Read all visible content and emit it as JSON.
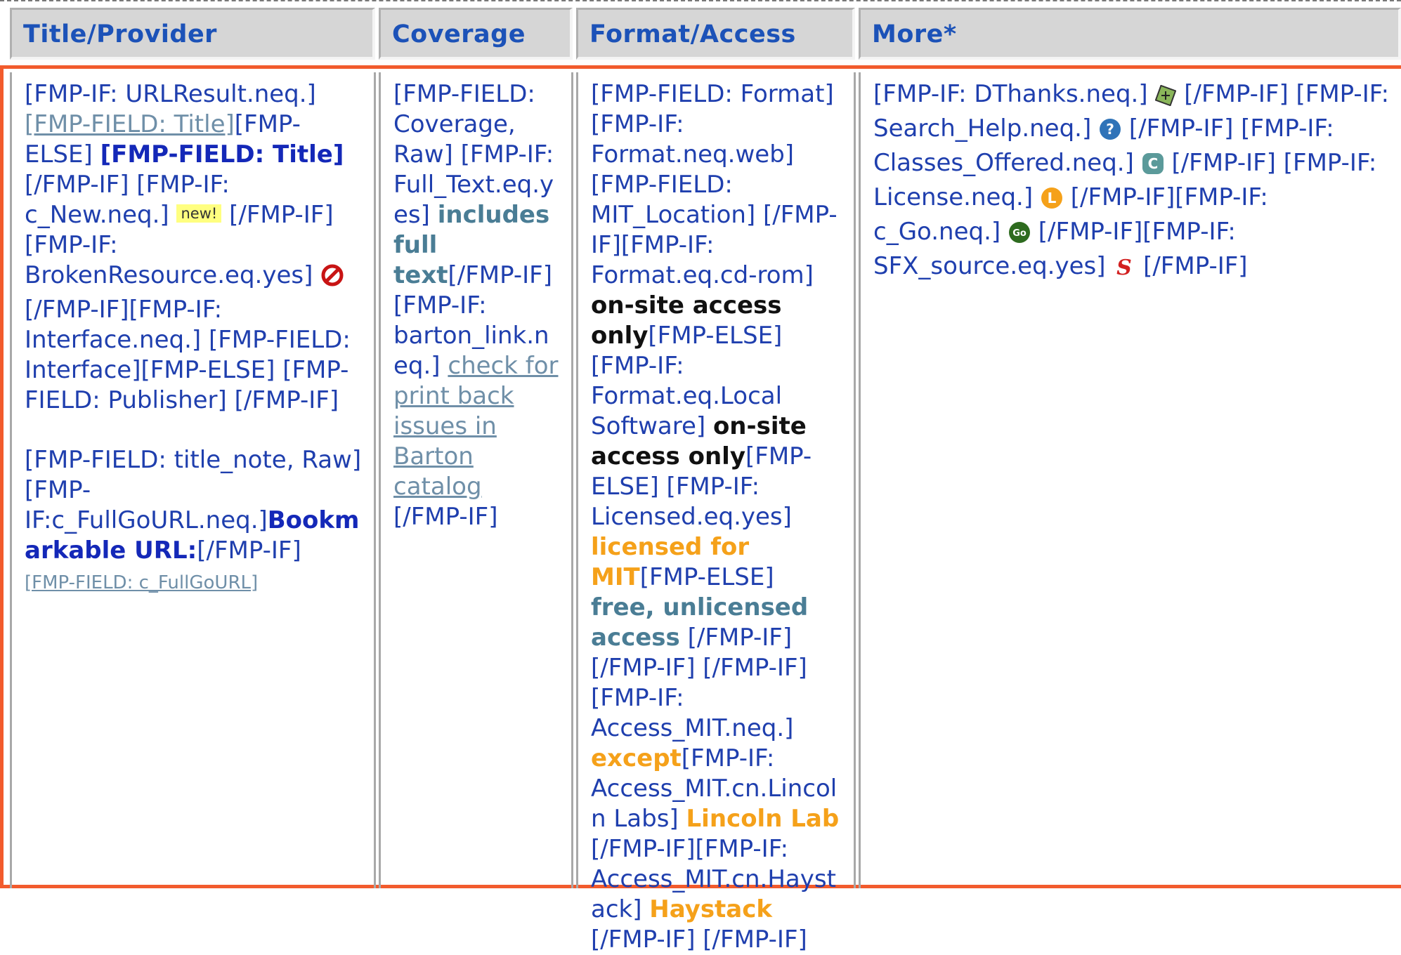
{
  "headers": {
    "title_provider": "Title/Provider",
    "coverage": "Coverage",
    "format_access": "Format/Access",
    "more": "More*"
  },
  "col1": {
    "p1_a": "[FMP-IF: URLResult.neq.] ",
    "p1_link": "[FMP-FIELD: Title]",
    "p1_b": "[FMP-ELSE] ",
    "p1_bold": "[FMP-FIELD: Title]",
    "p1_c": " [/FMP-IF] [FMP-IF: c_New.neq.] ",
    "new_badge": "new!",
    "p1_d": " [/FMP-IF][FMP-IF: BrokenResource.eq.yes] ",
    "p1_e": " [/FMP-IF][FMP-IF: Interface.neq.] [FMP-FIELD: Interface][FMP-ELSE] [FMP-FIELD: Publisher] [/FMP-IF]",
    "p2_a": "[FMP-FIELD: title_note, Raw] [FMP-IF:c_FullGoURL.neq.]",
    "p2_bold": "Bookmarkable URL:",
    "p2_b": "[/FMP-IF]",
    "p2_link": "[FMP-FIELD: c_FullGoURL]"
  },
  "col2": {
    "a": "[FMP-FIELD: Coverage, Raw] [FMP-IF: Full_Text.eq.yes] ",
    "bold": "includes full text",
    "b": "[/FMP-IF] [FMP-IF: barton_link.neq.] ",
    "link": "check for print back issues in Barton catalog",
    "c": " [/FMP-IF]"
  },
  "col3": {
    "a": "[FMP-FIELD: Format][FMP-IF: Format.neq.web] [FMP-FIELD: MIT_Location] [/FMP-IF][FMP-IF: Format.eq.cd-rom] ",
    "bold1": "on-site access only",
    "b": "[FMP-ELSE] [FMP-IF: Format.eq.Local Software] ",
    "bold2": "on-site access only",
    "c": "[FMP-ELSE] [FMP-IF: Licensed.eq.yes] ",
    "orange1": "licensed for MIT",
    "d": "[FMP-ELSE] ",
    "teal1": "free, unlicensed access",
    "e": " [/FMP-IF] [/FMP-IF] [/FMP-IF][FMP-IF: Access_MIT.neq.] ",
    "orange2": "except",
    "f": "[FMP-IF: Access_MIT.cn.Lincoln Labs] ",
    "orange3": "Lincoln Lab",
    "g": " [/FMP-IF][FMP-IF: Access_MIT.cn.Haystack] ",
    "orange4": "Haystack",
    "h": " [/FMP-IF] [/FMP-IF]"
  },
  "col4": {
    "a": "[FMP-IF: DThanks.neq.] ",
    "b": " [/FMP-IF] [FMP-IF: Search_Help.neq.] ",
    "c": " [/FMP-IF] [FMP-IF: Classes_Offered.neq.] ",
    "d": " [/FMP-IF] [FMP-IF: License.neq.] ",
    "e": " [/FMP-IF][FMP-IF: c_Go.neq.] ",
    "f": " [/FMP-IF][FMP-IF: SFX_source.eq.yes] ",
    "g": " [/FMP-IF]",
    "help_glyph": "?",
    "classes_glyph": "C",
    "license_glyph": "L",
    "go_glyph": "Go",
    "sfx_glyph": "S"
  },
  "colors": {
    "text": "#1f3fae",
    "header_text": "#1c52b8",
    "frame": "#f25b2d",
    "orange": "#f5a11a",
    "teal": "#4a7d95"
  }
}
